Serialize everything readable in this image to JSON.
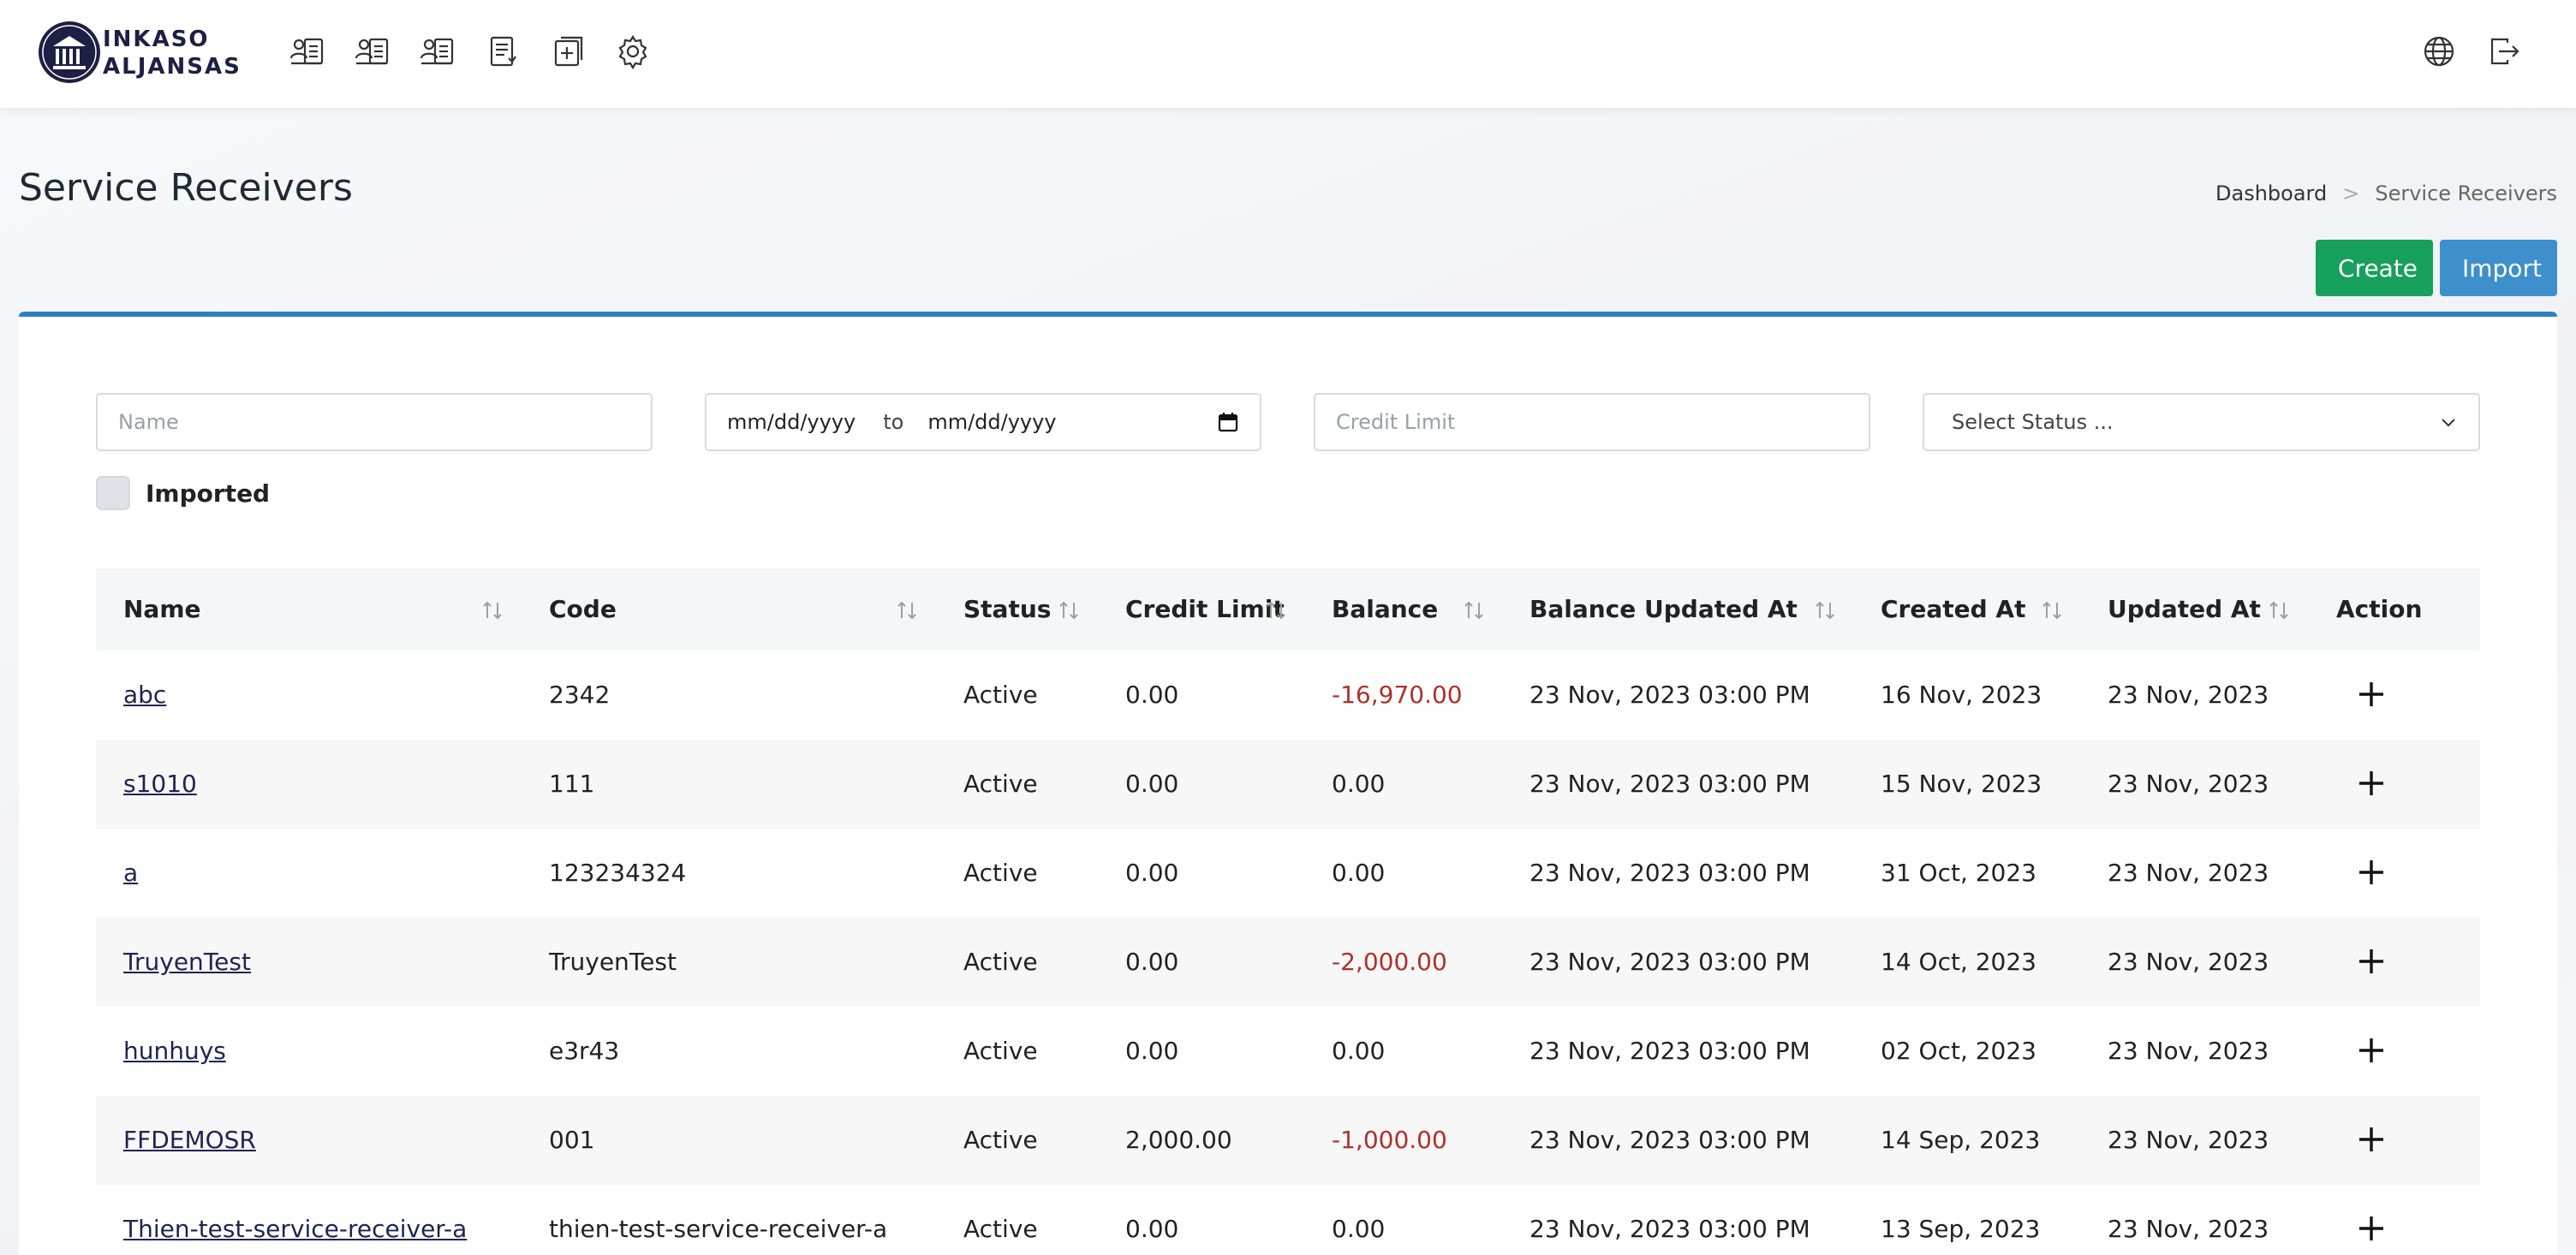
{
  "brand": {
    "line1": "INKASO",
    "line2": "ALJANSAS"
  },
  "nav": {
    "icons": [
      "contact-card-icon",
      "contact-card-icon",
      "contact-card-icon",
      "document-list-icon",
      "add-document-icon",
      "gear-icon"
    ],
    "right_icons": [
      "globe-icon",
      "logout-icon"
    ]
  },
  "page": {
    "title": "Service Receivers"
  },
  "breadcrumb": {
    "home": "Dashboard",
    "separator": ">",
    "current": "Service Receivers"
  },
  "actions": {
    "create": "Create",
    "import": "Import"
  },
  "filters": {
    "name_placeholder": "Name",
    "date_from": "mm/dd/yyyy",
    "date_to_label": "to",
    "date_to": "mm/dd/yyyy",
    "credit_placeholder": "Credit Limit",
    "status_placeholder": "Select Status ...",
    "imported_label": "Imported"
  },
  "table": {
    "headers": {
      "name": "Name",
      "code": "Code",
      "status": "Status",
      "credit": "Credit Limit",
      "balance": "Balance",
      "balance_updated": "Balance Updated At",
      "created": "Created At",
      "updated": "Updated At",
      "action": "Action"
    },
    "rows": [
      {
        "name": "abc",
        "code": "2342",
        "status": "Active",
        "credit": "0.00",
        "balance": "-16,970.00",
        "balance_updated": "23 Nov, 2023 03:00 PM",
        "created": "16 Nov, 2023",
        "updated": "23 Nov, 2023"
      },
      {
        "name": "s1010",
        "code": "111",
        "status": "Active",
        "credit": "0.00",
        "balance": "0.00",
        "balance_updated": "23 Nov, 2023 03:00 PM",
        "created": "15 Nov, 2023",
        "updated": "23 Nov, 2023"
      },
      {
        "name": "a",
        "code": "123234324",
        "status": "Active",
        "credit": "0.00",
        "balance": "0.00",
        "balance_updated": "23 Nov, 2023 03:00 PM",
        "created": "31 Oct, 2023",
        "updated": "23 Nov, 2023"
      },
      {
        "name": "TruyenTest",
        "code": "TruyenTest",
        "status": "Active",
        "credit": "0.00",
        "balance": "-2,000.00",
        "balance_updated": "23 Nov, 2023 03:00 PM",
        "created": "14 Oct, 2023",
        "updated": "23 Nov, 2023"
      },
      {
        "name": "hunhuys",
        "code": "e3r43",
        "status": "Active",
        "credit": "0.00",
        "balance": "0.00",
        "balance_updated": "23 Nov, 2023 03:00 PM",
        "created": "02 Oct, 2023",
        "updated": "23 Nov, 2023"
      },
      {
        "name": "FFDEMOSR",
        "code": "001",
        "status": "Active",
        "credit": "2,000.00",
        "balance": "-1,000.00",
        "balance_updated": "23 Nov, 2023 03:00 PM",
        "created": "14 Sep, 2023",
        "updated": "23 Nov, 2023"
      },
      {
        "name": "Thien-test-service-receiver-a",
        "code": "thien-test-service-receiver-a",
        "status": "Active",
        "credit": "0.00",
        "balance": "0.00",
        "balance_updated": "23 Nov, 2023 03:00 PM",
        "created": "13 Sep, 2023",
        "updated": "23 Nov, 2023"
      }
    ]
  },
  "colors": {
    "primary_border": "#2d7fc1",
    "create_button": "#16a05b",
    "import_button": "#3e8fcc",
    "negative_balance": "#b0302a",
    "brand_navy": "#1e1f44"
  }
}
